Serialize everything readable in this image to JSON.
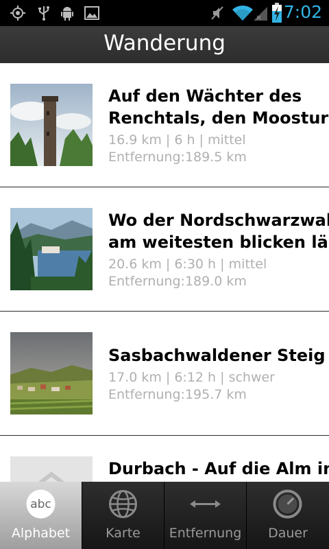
{
  "status_bar": {
    "time": "7:02",
    "icons": [
      "gps-icon",
      "usb-icon",
      "android-debug-icon",
      "gallery-icon",
      "mute-icon",
      "wifi-icon",
      "signal-icon",
      "battery-charging-icon"
    ]
  },
  "title_bar": {
    "title": "Wanderung"
  },
  "list": {
    "items": [
      {
        "title_line1": "Auf den Wächter des",
        "title_line2": "Renchtals, den Moosturm",
        "info": "16.9 km | 6 h | mittel",
        "distance": "Entfernung:189.5 km",
        "image": "tower-photo"
      },
      {
        "title_line1": "Wo der Nordschwarzwald",
        "title_line2": "am weitesten blicken lässt",
        "info": "20.6 km | 6:30 h | mittel",
        "distance": "Entfernung:189.0 km",
        "image": "lake-forest-photo"
      },
      {
        "title_line1": "Sasbachwaldener Steig",
        "title_line2": "",
        "info": "17.0 km | 6:12 h | schwer",
        "distance": "Entfernung:195.7 km",
        "image": "village-hills-photo"
      },
      {
        "title_line1": "Durbach - Auf die Alm in",
        "title_line2": "",
        "info": "",
        "distance": "",
        "image": "placeholder-photo"
      }
    ]
  },
  "tabs": [
    {
      "label": "Alphabet",
      "icon": "abc-icon",
      "icon_text": "abc",
      "active": true
    },
    {
      "label": "Karte",
      "icon": "globe-icon",
      "active": false
    },
    {
      "label": "Entfernung",
      "icon": "double-arrow-icon",
      "active": false
    },
    {
      "label": "Dauer",
      "icon": "clock-icon",
      "active": false
    }
  ],
  "colors": {
    "accent": "#33b5e5",
    "secondary_text": "#b0b0b0"
  }
}
